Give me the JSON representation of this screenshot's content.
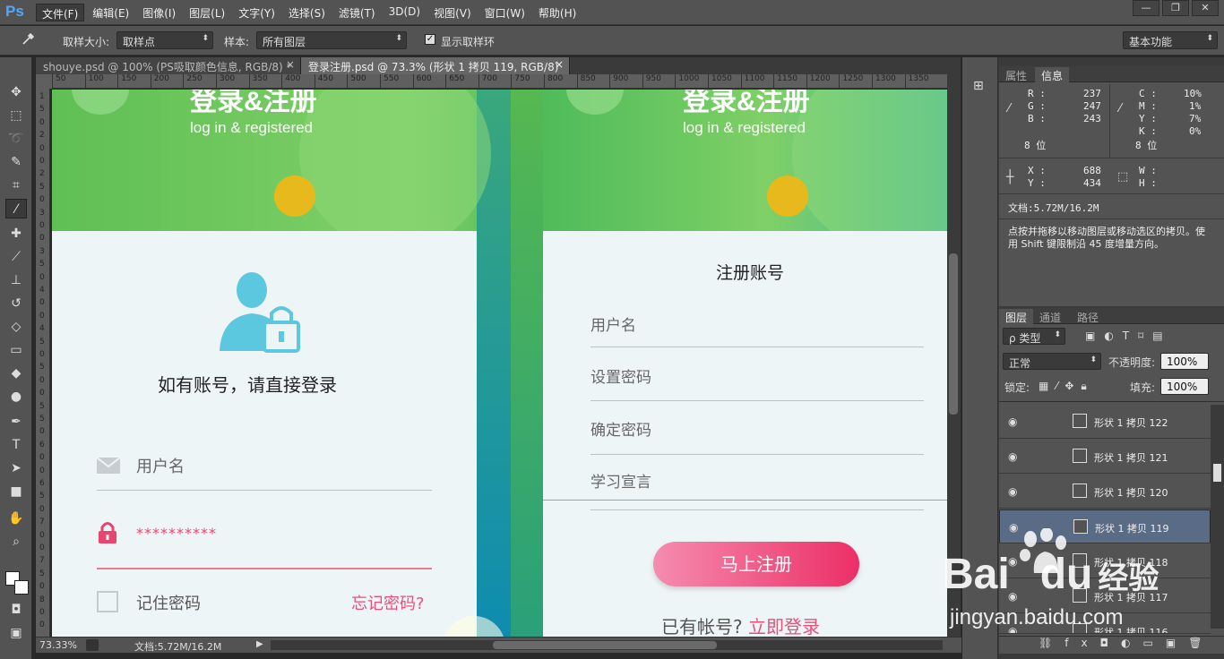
{
  "app": {
    "logo": "Ps"
  },
  "menu": [
    "文件(F)",
    "编辑(E)",
    "图像(I)",
    "图层(L)",
    "文字(Y)",
    "选择(S)",
    "滤镜(T)",
    "3D(D)",
    "视图(V)",
    "窗口(W)",
    "帮助(H)"
  ],
  "window_buttons": {
    "minimize": "—",
    "restore": "❐",
    "close": "✕"
  },
  "options": {
    "sample_size_label": "取样大小:",
    "sample_size_value": "取样点",
    "sample_label": "样本:",
    "sample_value": "所有图层",
    "show_ring_label": "显示取样环",
    "show_ring_checked": "✓",
    "workspace": "基本功能"
  },
  "tabs": [
    {
      "label": "shouye.psd @ 100% (PS吸取颜色信息, RGB/8) *",
      "close": "×"
    },
    {
      "label": "登录注册.psd @ 73.3% (形状 1 拷贝 119, RGB/8) *",
      "close": "×"
    }
  ],
  "ruler_h": [
    "50",
    "100",
    "150",
    "200",
    "250",
    "300",
    "350",
    "400",
    "450",
    "500",
    "550",
    "600",
    "650",
    "700",
    "750",
    "800",
    "850",
    "900",
    "950",
    "1000",
    "1050",
    "1100",
    "1150",
    "1200",
    "1250",
    "1300",
    "1350"
  ],
  "ruler_v": [
    "1",
    "5",
    "0",
    "2",
    "0",
    "0",
    "2",
    "5",
    "0",
    "3",
    "0",
    "0",
    "3",
    "5",
    "0",
    "4",
    "0",
    "0",
    "4",
    "5",
    "0",
    "5",
    "0",
    "0",
    "5",
    "5",
    "0",
    "6",
    "0",
    "0",
    "6",
    "5",
    "0",
    "7",
    "0",
    "0",
    "7",
    "5",
    "0",
    "8",
    "0",
    "0"
  ],
  "login": {
    "title": "登录&注册",
    "subtitle": "log in & registered",
    "heading": "如有账号，请直接登录",
    "username_placeholder": "用户名",
    "password_value": "**********",
    "remember": "记住密码",
    "forgot": "忘记密码?"
  },
  "register": {
    "title": "登录&注册",
    "subtitle": "log in & registered",
    "heading": "注册账号",
    "fields": [
      "用户名",
      "设置密码",
      "确定密码",
      "学习宣言"
    ],
    "submit": "马上注册",
    "have_account": "已有帐号?",
    "login_link": "立即登录"
  },
  "info_panel": {
    "tabs": [
      "属性",
      "信息"
    ],
    "r_label": "R :",
    "r_val": "237",
    "g_label": "G :",
    "g_val": "247",
    "b_label": "B :",
    "b_val": "243",
    "bit_left": "8 位",
    "c_label": "C :",
    "c_val": "10%",
    "m_label": "M :",
    "m_val": "1%",
    "y_label": "Y :",
    "y_val": "7%",
    "k_label": "K :",
    "k_val": "0%",
    "bit_right": "8 位",
    "x_label": "X :",
    "x_val": "688",
    "yy_label": "Y :",
    "yy_val": "434",
    "w_label": "W :",
    "h_label": "H :",
    "doc": "文档:5.72M/16.2M",
    "hint": "点按并拖移以移动图层或移动选区的拷贝。使用 Shift 键限制沿 45 度增量方向。"
  },
  "layers_panel": {
    "tabs": [
      "图层",
      "通道",
      "路径"
    ],
    "filter": "ρ 类型",
    "blend": "正常",
    "opacity_label": "不透明度:",
    "opacity": "100%",
    "lock_label": "锁定:",
    "fill_label": "填充:",
    "fill": "100%",
    "layers": [
      "形状 1 拷贝 122",
      "形状 1 拷贝 121",
      "形状 1 拷贝 120",
      "形状 1 拷贝 119",
      "形状 1 拷贝 118",
      "形状 1 拷贝 117",
      "形状 1 拷贝 116"
    ],
    "selected_index": 3
  },
  "status": {
    "zoom": "73.33%",
    "doc": "文档:5.72M/16.2M"
  },
  "watermark": {
    "brand": "Bai",
    "brand2": "du",
    "suffix": "经验",
    "url": "jingyan.baidu.com"
  },
  "colors": {
    "green": "#7fd066",
    "pink": "#f0467a",
    "cyan": "#5bc8e0",
    "yellow": "#e8b91c"
  }
}
